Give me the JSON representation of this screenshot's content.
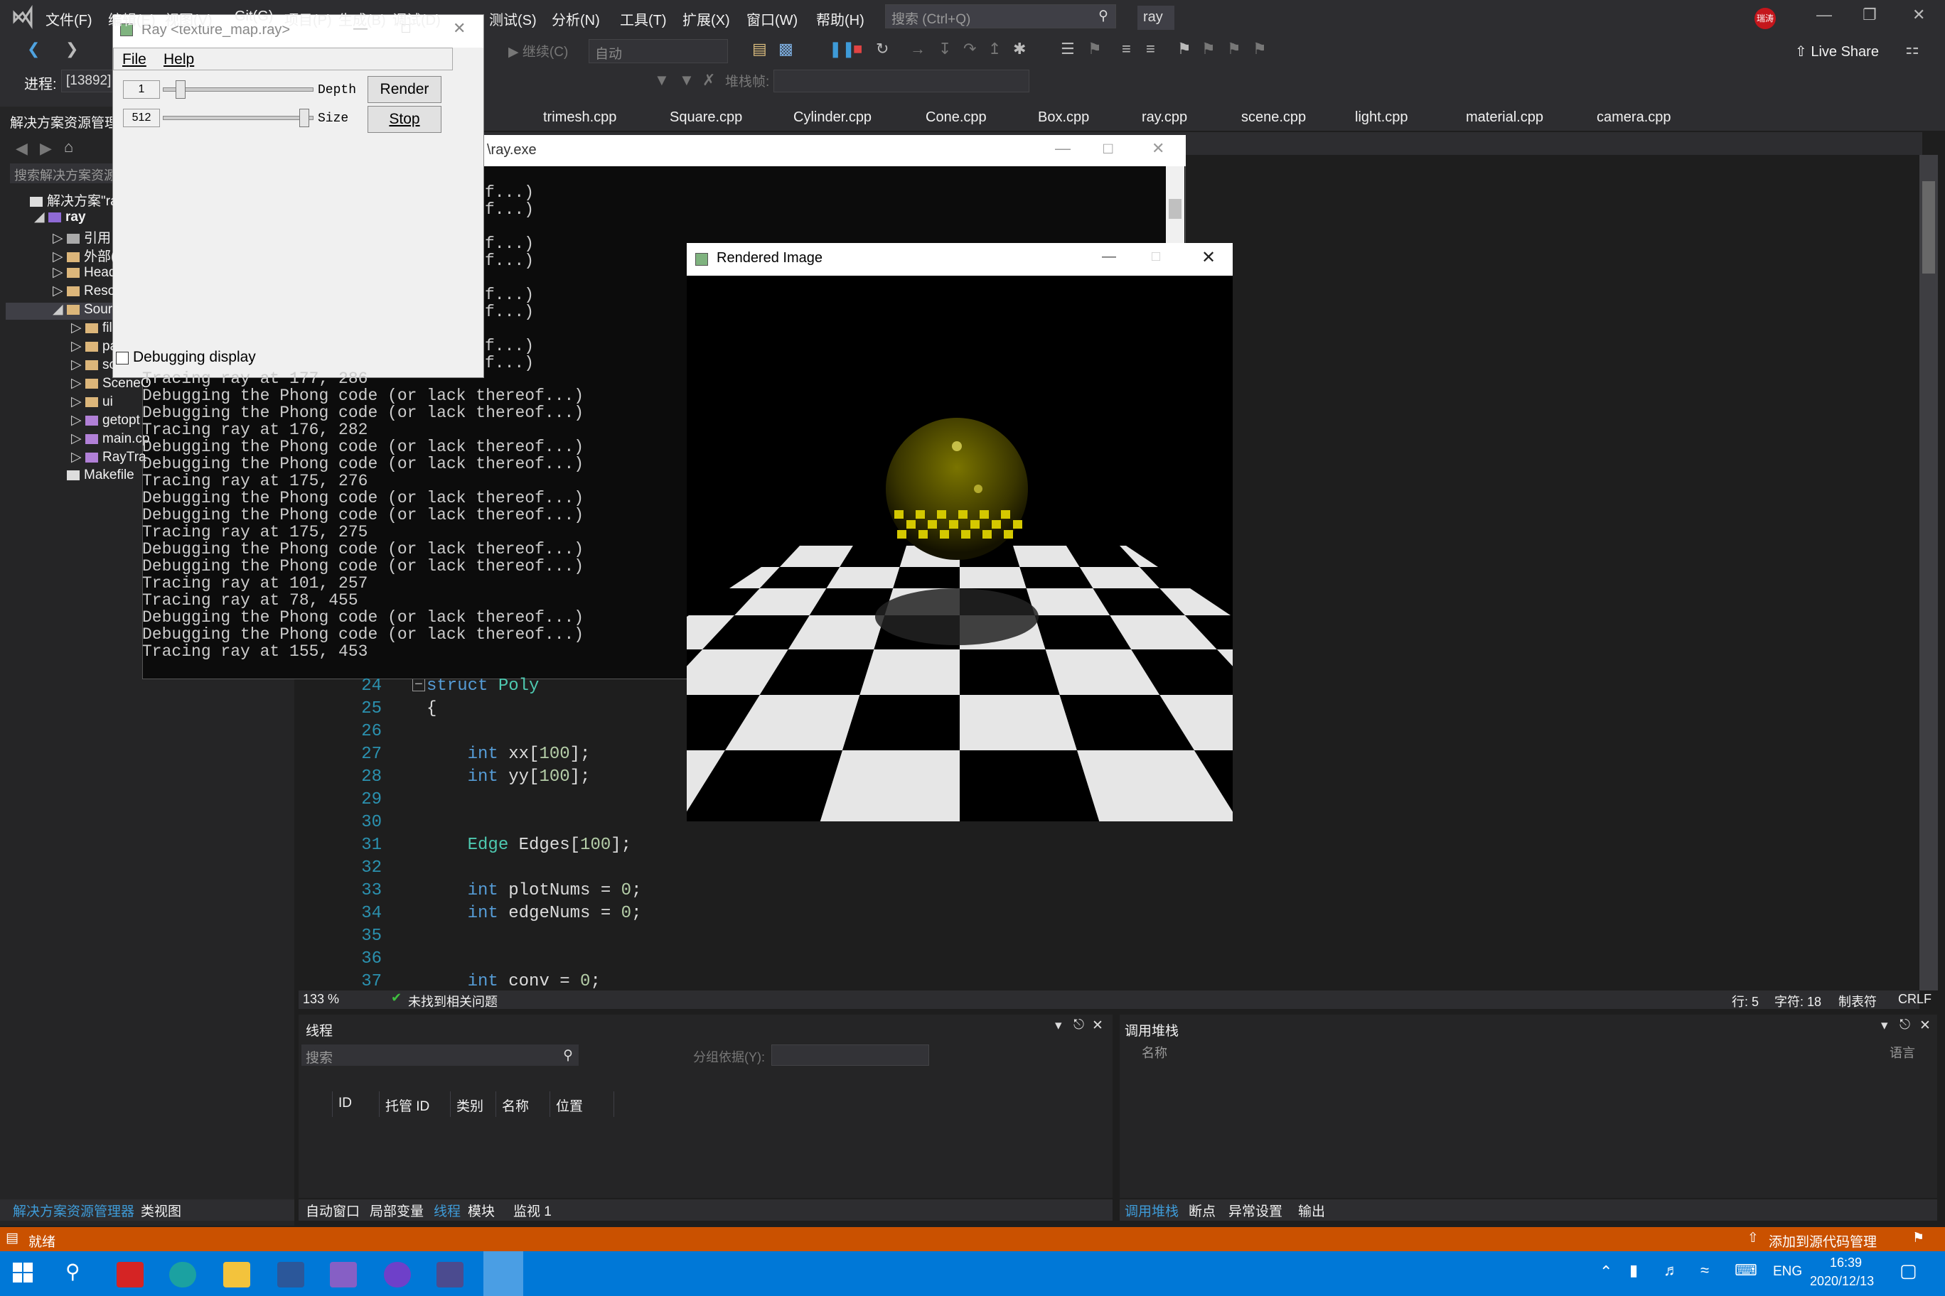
{
  "menubar": {
    "items": [
      "文件(F)",
      "编辑(E)",
      "视图(V)",
      "Git(G)",
      "项目(P)",
      "生成(B)",
      "调试(D)",
      "测试(S)",
      "分析(N)",
      "工具(T)",
      "扩展(X)",
      "窗口(W)",
      "帮助(H)"
    ],
    "search_placeholder": "搜索 (Ctrl+Q)",
    "project_name": "ray",
    "user_badge": "瑞涛"
  },
  "toolbar": {
    "continue_label": "继续(C)",
    "auto_combo": "自动",
    "live_share": "Live Share",
    "process_label": "进程:",
    "process_value": "[13892]",
    "stackframe_label": "堆栈帧:"
  },
  "solution_explorer": {
    "title": "解决方案资源管理器",
    "search_placeholder": "搜索解决方案资源",
    "items": [
      {
        "label": "解决方案\"ra",
        "indent": 0
      },
      {
        "label": "ray",
        "indent": 1
      },
      {
        "label": "引用",
        "indent": 2
      },
      {
        "label": "外部(",
        "indent": 2
      },
      {
        "label": "Head",
        "indent": 2
      },
      {
        "label": "Reso",
        "indent": 2
      },
      {
        "label": "Sourc",
        "indent": 2
      },
      {
        "label": "fil",
        "indent": 3
      },
      {
        "label": "pa",
        "indent": 3
      },
      {
        "label": "sc",
        "indent": 3
      },
      {
        "label": "SceneO",
        "indent": 3
      },
      {
        "label": "ui",
        "indent": 3
      },
      {
        "label": "getopt",
        "indent": 3
      },
      {
        "label": "main.cp",
        "indent": 3
      },
      {
        "label": "RayTra",
        "indent": 3
      },
      {
        "label": "Makefile",
        "indent": 2
      }
    ],
    "bottom_tabs": [
      "解决方案资源管理器",
      "类视图"
    ]
  },
  "tabs": [
    "trimesh.cpp",
    "Square.cpp",
    "Cylinder.cpp",
    "Cone.cpp",
    "Box.cpp",
    "ray.cpp",
    "scene.cpp",
    "light.cpp",
    "material.cpp",
    "camera.cpp"
  ],
  "editor": {
    "lines": [
      {
        "n": "24",
        "text": "struct Poly"
      },
      {
        "n": "25",
        "text": "{"
      },
      {
        "n": "26",
        "text": ""
      },
      {
        "n": "27",
        "text": "    int xx[100];"
      },
      {
        "n": "28",
        "text": "    int yy[100];"
      },
      {
        "n": "29",
        "text": ""
      },
      {
        "n": "30",
        "text": ""
      },
      {
        "n": "31",
        "text": "    Edge Edges[100];"
      },
      {
        "n": "32",
        "text": ""
      },
      {
        "n": "33",
        "text": "    int plotNums = 0;"
      },
      {
        "n": "34",
        "text": "    int edgeNums = 0;"
      },
      {
        "n": "35",
        "text": ""
      },
      {
        "n": "36",
        "text": ""
      },
      {
        "n": "37",
        "text": "    int conv = 0;"
      }
    ],
    "zoom": "133 %",
    "issues": "未找到相关问题",
    "row": "行: 5",
    "col": "字符: 18",
    "tab_mode": "制表符",
    "eol": "CRLF"
  },
  "threads_pane": {
    "title": "线程",
    "search_placeholder": "搜索",
    "group_by": "分组依据(Y):",
    "columns": [
      "ID",
      "托管 ID",
      "类别",
      "名称",
      "位置"
    ],
    "bottom_tabs": [
      "自动窗口",
      "局部变量",
      "线程",
      "模块",
      "监视 1"
    ]
  },
  "callstack_pane": {
    "title": "调用堆栈",
    "col_name": "名称",
    "col_lang": "语言",
    "bottom_tabs": [
      "调用堆栈",
      "断点",
      "异常设置",
      "输出"
    ]
  },
  "statusbar": {
    "ready": "就绪",
    "source_control": "添加到源代码管理"
  },
  "taskbar": {
    "lang": "ENG",
    "time": "16:39",
    "date": "2020/12/13"
  },
  "ray_window": {
    "title": "Ray <texture_map.ray>",
    "menu": [
      "File",
      "Help"
    ],
    "depth_value": "1",
    "depth_label": "Depth",
    "size_value": "512",
    "size_label": "Size",
    "render_label": "Render",
    "stop_label": "Stop",
    "debug_label": "Debugging display"
  },
  "console": {
    "title": "\\ray.exe",
    "partial_lines": [
      "f...)",
      "f...)",
      "f...)",
      "f...)",
      "f...)",
      "f...)",
      "f...)",
      "f...)"
    ],
    "lines": [
      "Tracing ray at 177, 286",
      "Debugging the Phong code (or lack thereof...)",
      "Debugging the Phong code (or lack thereof...)",
      "Tracing ray at 176, 282",
      "Debugging the Phong code (or lack thereof...)",
      "Debugging the Phong code (or lack thereof...)",
      "Tracing ray at 175, 276",
      "Debugging the Phong code (or lack thereof...)",
      "Debugging the Phong code (or lack thereof...)",
      "Tracing ray at 175, 275",
      "Debugging the Phong code (or lack thereof...)",
      "Debugging the Phong code (or lack thereof...)",
      "Tracing ray at 101, 257",
      "Tracing ray at 78, 455",
      "Debugging the Phong code (or lack thereof...)",
      "Debugging the Phong code (or lack thereof...)",
      "Tracing ray at 155, 453"
    ]
  },
  "render_window": {
    "title": "Rendered Image"
  },
  "colors": {
    "accent": "#007acc",
    "statusbar": "#ca5100",
    "taskbar": "#0078d7",
    "keyword": "#569cd6",
    "type": "#4ec9b0",
    "line_number": "#2b91af"
  }
}
